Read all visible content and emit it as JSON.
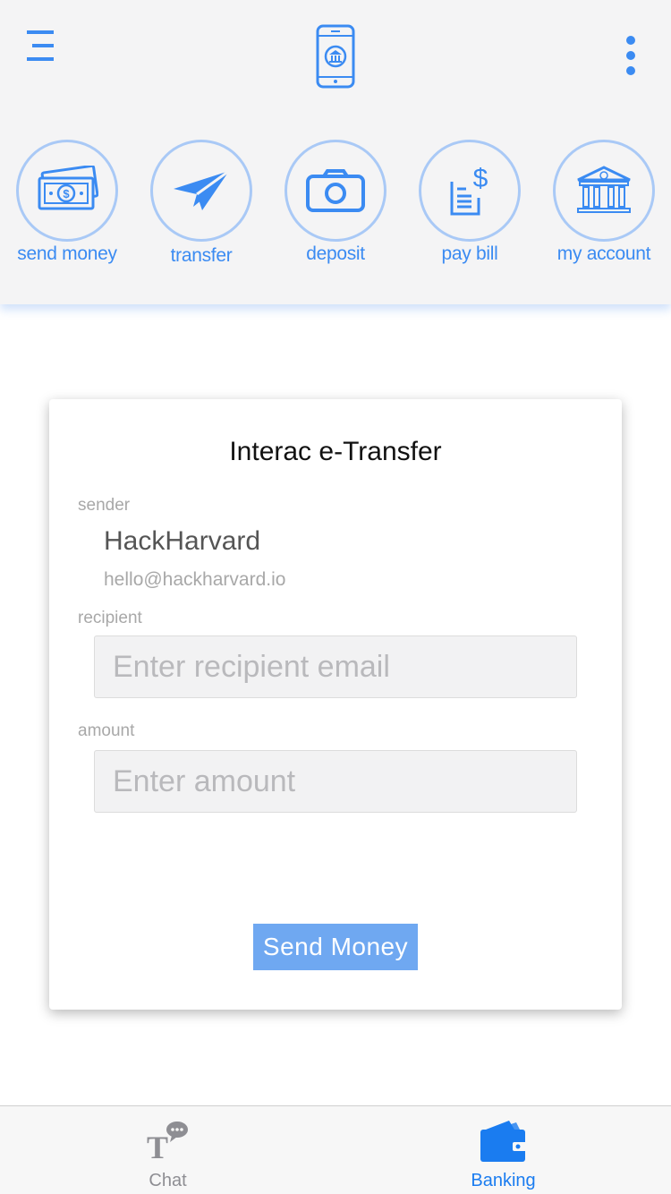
{
  "header": {
    "menu_icon": "hamburger-menu-icon",
    "logo_icon": "phone-bank-icon",
    "more_icon": "more-vertical-icon"
  },
  "actions": [
    {
      "label": "send money",
      "icon": "money-bill-icon"
    },
    {
      "label": "transfer",
      "icon": "paper-plane-icon"
    },
    {
      "label": "deposit",
      "icon": "camera-icon"
    },
    {
      "label": "pay bill",
      "icon": "bill-dollar-icon"
    },
    {
      "label": "my account",
      "icon": "bank-building-icon"
    }
  ],
  "form": {
    "title": "Interac e-Transfer",
    "sender_label": "sender",
    "sender_name": "HackHarvard",
    "sender_email": "hello@hackharvard.io",
    "recipient_label": "recipient",
    "recipient_value": "",
    "recipient_placeholder": "Enter recipient email",
    "amount_label": "amount",
    "amount_value": "",
    "amount_placeholder": "Enter amount",
    "submit_label": "Send Money"
  },
  "tabs": [
    {
      "label": "Chat",
      "icon": "chat-text-icon",
      "active": false
    },
    {
      "label": "Banking",
      "icon": "wallet-icon",
      "active": true
    }
  ],
  "colors": {
    "accent": "#3b8bf2",
    "circle_border": "#a9c9f6",
    "button_bg": "#6fa8f1",
    "inactive_tab": "#8e8e93",
    "header_bg": "#f4f4f5"
  }
}
